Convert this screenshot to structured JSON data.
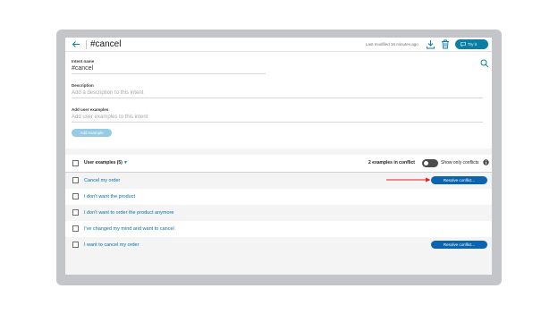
{
  "header": {
    "title": "#cancel",
    "last_modified": "Last modified 16 minutes ago",
    "try_label": "Try it"
  },
  "form": {
    "intent_name_label": "Intent name",
    "intent_name_value": "#cancel",
    "description_label": "Description",
    "description_placeholder": "Add a description to this intent",
    "examples_label": "Add user examples",
    "examples_placeholder": "Add user examples to this intent",
    "add_example_label": "Add example"
  },
  "list": {
    "header_label": "User examples (5)",
    "caret": "▼",
    "conflict_count": "2 examples in conflict",
    "toggle_label": "Show only conflicts",
    "rows": [
      {
        "text": "Cancel my order",
        "conflict": true
      },
      {
        "text": "I don't want the product",
        "conflict": false
      },
      {
        "text": "I don't want to order the product anymore",
        "conflict": false
      },
      {
        "text": "I've changed my mind and want to cancel",
        "conflict": false
      },
      {
        "text": "I want to cancel my order",
        "conflict": true
      }
    ],
    "resolve_label": "Resolve conflict..."
  },
  "colors": {
    "accent": "#0a7fa3",
    "link": "#0a6fa0",
    "resolve_button": "#0a64b0",
    "annotation_arrow": "#d9252a"
  },
  "icons": [
    "back-arrow-icon",
    "download-icon",
    "trash-icon",
    "chat-icon",
    "search-icon",
    "info-icon"
  ]
}
